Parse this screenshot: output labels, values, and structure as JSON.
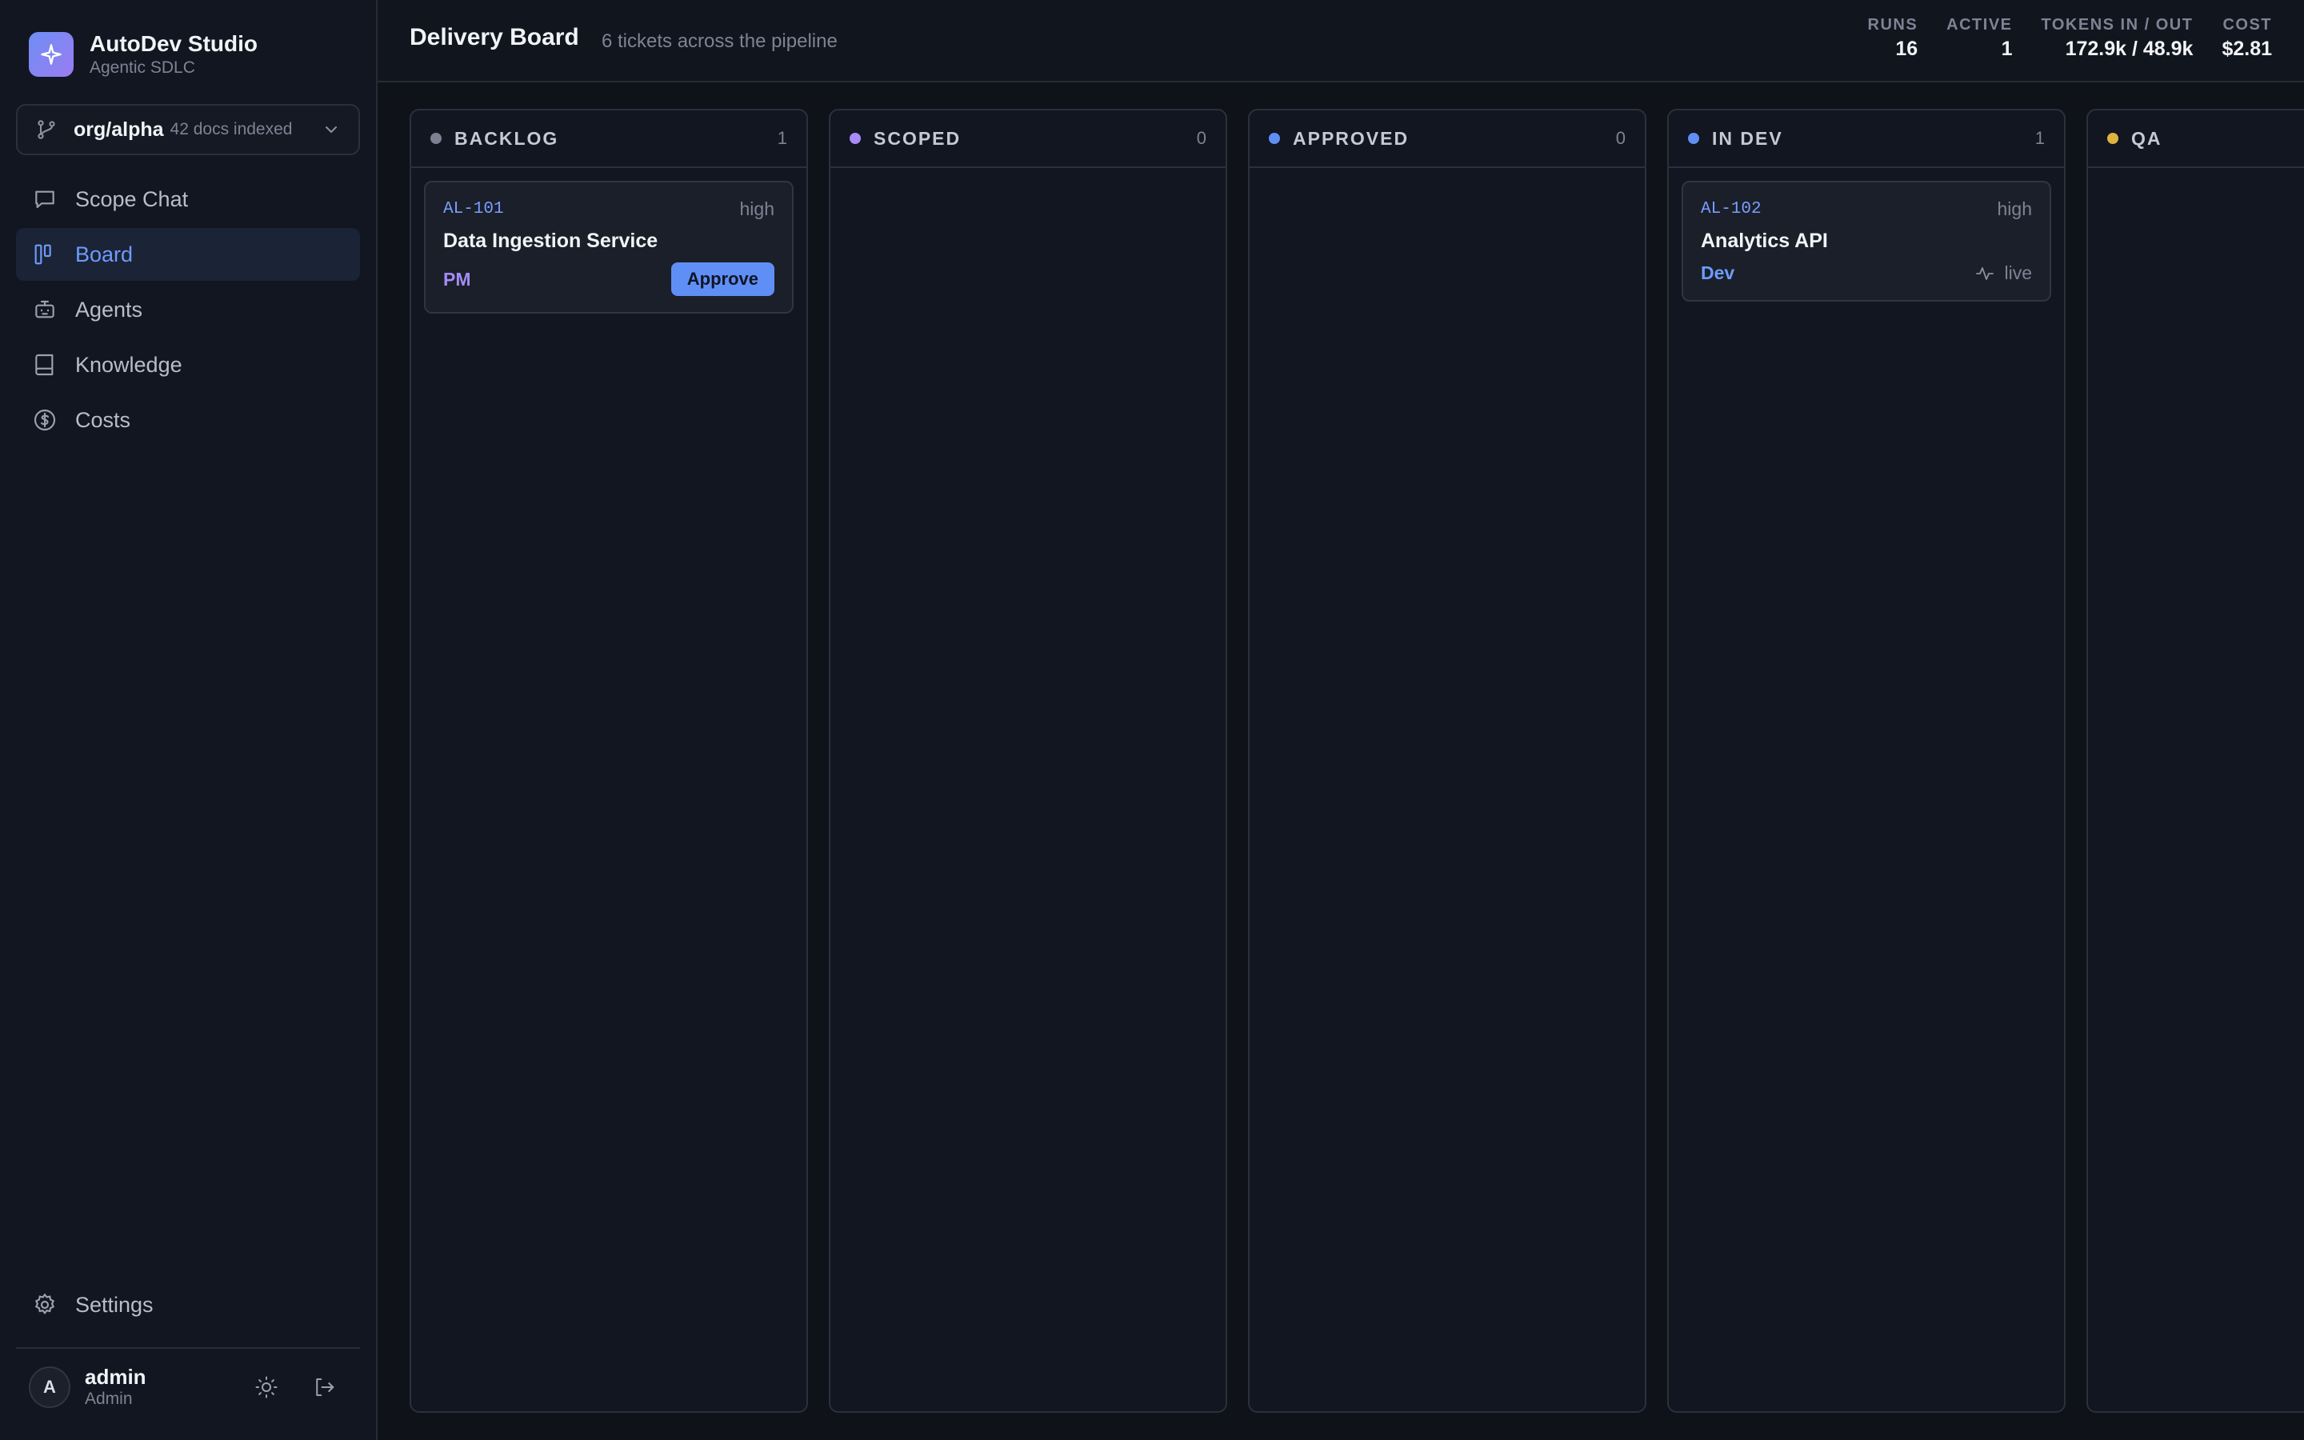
{
  "brand": {
    "title": "AutoDev Studio",
    "subtitle": "Agentic SDLC"
  },
  "repo": {
    "name": "org/alpha",
    "docs": "42 docs indexed"
  },
  "nav": {
    "items": [
      {
        "label": "Scope Chat",
        "icon": "chat-icon"
      },
      {
        "label": "Board",
        "icon": "board-icon",
        "active": true
      },
      {
        "label": "Agents",
        "icon": "robot-icon"
      },
      {
        "label": "Knowledge",
        "icon": "book-icon"
      },
      {
        "label": "Costs",
        "icon": "dollar-icon"
      }
    ],
    "settings": "Settings"
  },
  "user": {
    "initial": "A",
    "name": "admin",
    "role": "Admin"
  },
  "header": {
    "title": "Delivery Board",
    "subtitle": "6 tickets across the pipeline",
    "stats": [
      {
        "label": "RUNS",
        "value": "16"
      },
      {
        "label": "ACTIVE",
        "value": "1"
      },
      {
        "label": "TOKENS IN / OUT",
        "value": "172.9k / 48.9k"
      },
      {
        "label": "COST",
        "value": "$2.81"
      }
    ]
  },
  "columns": [
    {
      "title": "BACKLOG",
      "count": "1",
      "color": "#7b8190",
      "cards": [
        {
          "id": "AL-101",
          "priority": "high",
          "title": "Data Ingestion Service",
          "role": "PM",
          "role_color": "#a48bf5",
          "action": "Approve"
        }
      ]
    },
    {
      "title": "SCOPED",
      "count": "0",
      "color": "#a78bfa",
      "cards": []
    },
    {
      "title": "APPROVED",
      "count": "0",
      "color": "#5f8ff5",
      "cards": []
    },
    {
      "title": "IN DEV",
      "count": "1",
      "color": "#5f8ff5",
      "cards": [
        {
          "id": "AL-102",
          "priority": "high",
          "title": "Analytics API",
          "role": "Dev",
          "role_color": "#6f9bff",
          "status": "live"
        }
      ]
    },
    {
      "title": "QA",
      "count": "",
      "color": "#e0b341",
      "cards": []
    }
  ]
}
